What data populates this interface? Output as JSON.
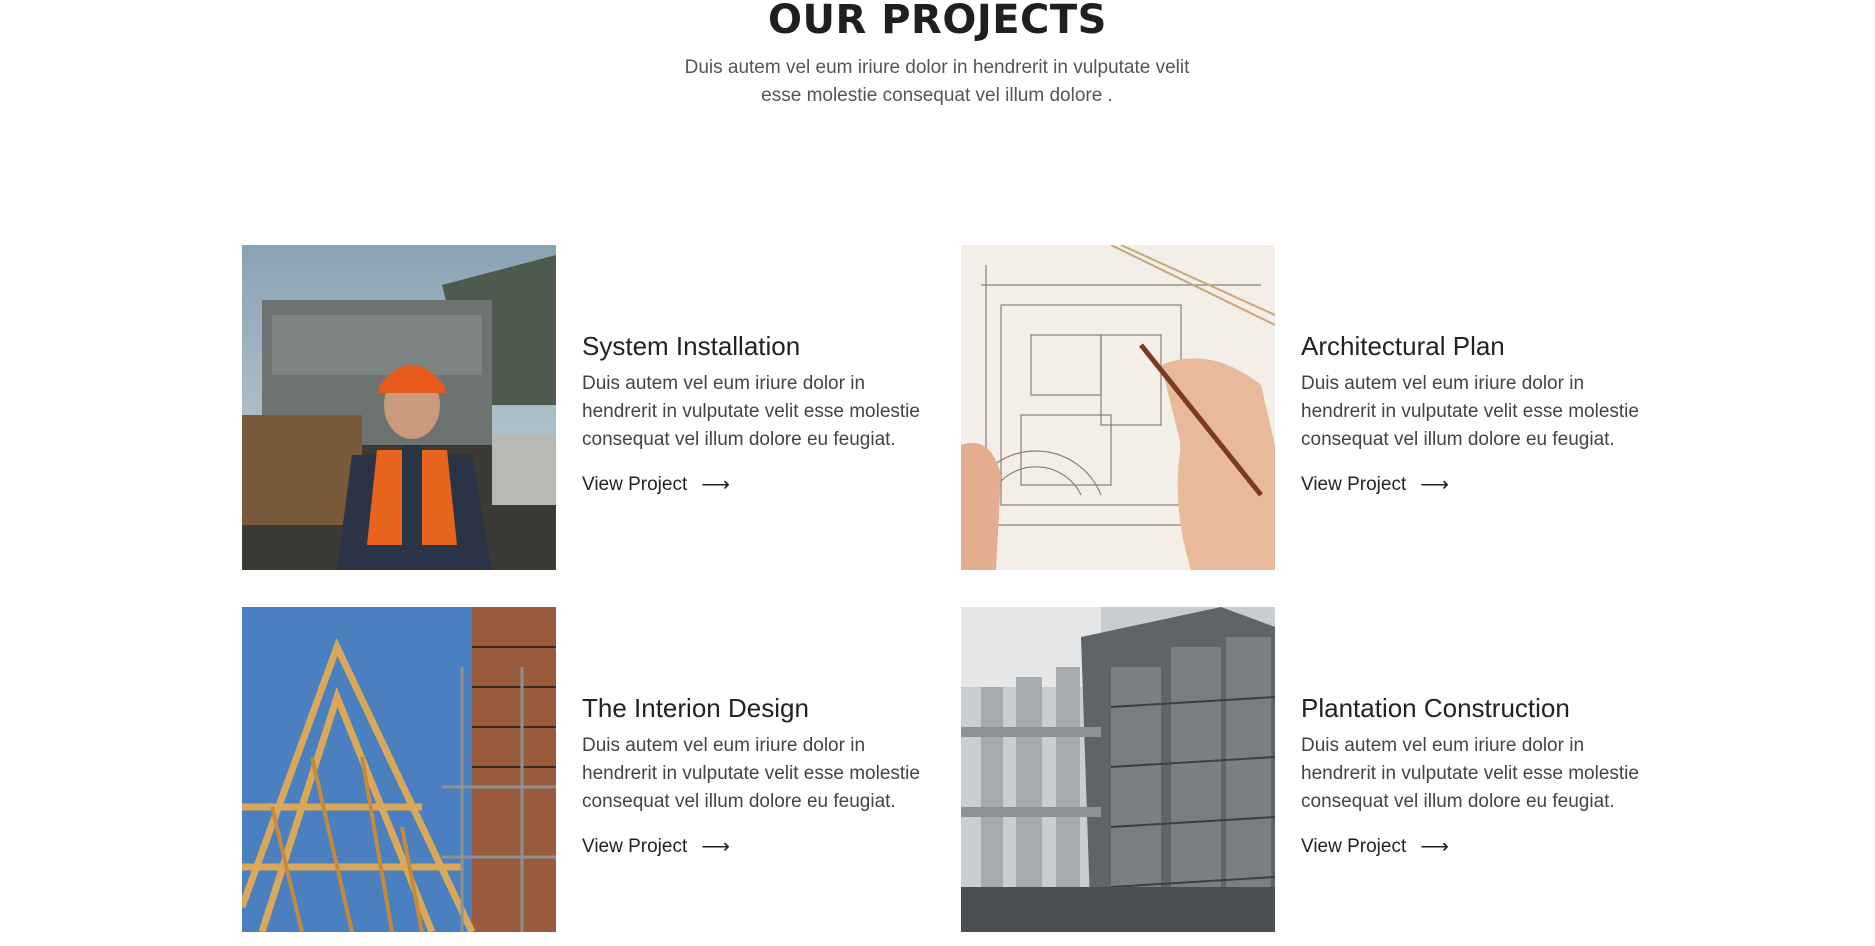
{
  "section": {
    "title": "OUR PROJECTS",
    "subtitle": "Duis autem vel eum iriure dolor in hendrerit in vulputate velit esse molestie consequat vel illum dolore ."
  },
  "projects": [
    {
      "title": "System Installation",
      "description": "Duis autem vel eum iriure dolor in hendrerit in vulputate velit esse molestie consequat vel illum dolore eu feugiat.",
      "link_label": "View Project",
      "image": "construction-worker-photo"
    },
    {
      "title": "Architectural Plan",
      "description": "Duis autem vel eum iriure dolor in hendrerit in vulputate velit esse molestie consequat vel illum dolore eu feugiat.",
      "link_label": "View Project",
      "image": "blueprint-drawing-photo"
    },
    {
      "title": "The Interion Design",
      "description": "Duis autem vel eum iriure dolor in hendrerit in vulputate velit esse molestie consequat vel illum dolore eu feugiat.",
      "link_label": "View Project",
      "image": "roof-truss-scaffold-photo"
    },
    {
      "title": "Plantation Construction",
      "description": "Duis autem vel eum iriure dolor in hendrerit in vulputate velit esse molestie consequat vel illum dolore eu feugiat.",
      "link_label": "View Project",
      "image": "industrial-plant-photo"
    }
  ],
  "icons": {
    "link_arrow": "arrow-right-icon"
  }
}
